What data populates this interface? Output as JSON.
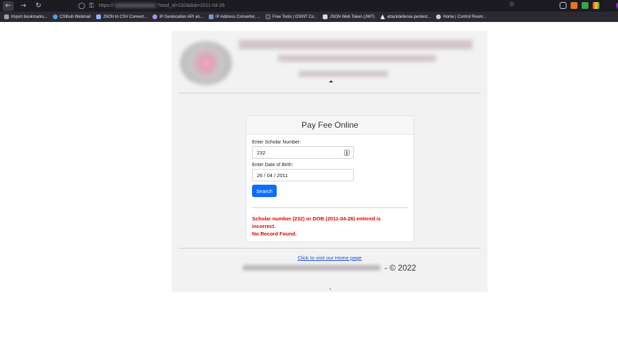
{
  "browser": {
    "url_scheme": "https://",
    "url_path": "?stud_id=232&dob=2011-04-26",
    "bookmarks": [
      {
        "label": "Import bookmarks...",
        "color": "#9e9ea6"
      },
      {
        "label": "CSIhub Webmail",
        "color": "#4aa3df"
      },
      {
        "label": "JSON to CSV Convert...",
        "color": "#8ab4f8"
      },
      {
        "label": "IP Geolocation API an...",
        "color": "#b38bfa"
      },
      {
        "label": "IP Address Converter, ...",
        "color": "#6c9bd2"
      },
      {
        "label": "Free Tools | OSINT Co...",
        "color": "#444"
      },
      {
        "label": "JSON Web Token (JWT)",
        "color": "#d8d8d8"
      },
      {
        "label": "attackdefense.pentest...",
        "color": "#e8e8e8"
      },
      {
        "label": "Home | Control Room...",
        "color": "#cccccc"
      }
    ]
  },
  "form": {
    "title": "Pay Fee Online",
    "scholar_label": "Enter Scholar Number:",
    "scholar_value": "232",
    "dob_label": "Enter Date of Birth:",
    "dob_value": "26 / 04 / 2011",
    "search_label": "Search"
  },
  "error": {
    "line1": "Scholar number (232) or DOB (2011-04-26) entered is",
    "line2": "incorrect.",
    "line3": "No Record Found."
  },
  "footer": {
    "home_link": "Click to visit our Home page",
    "copyright": "- © 2022"
  }
}
